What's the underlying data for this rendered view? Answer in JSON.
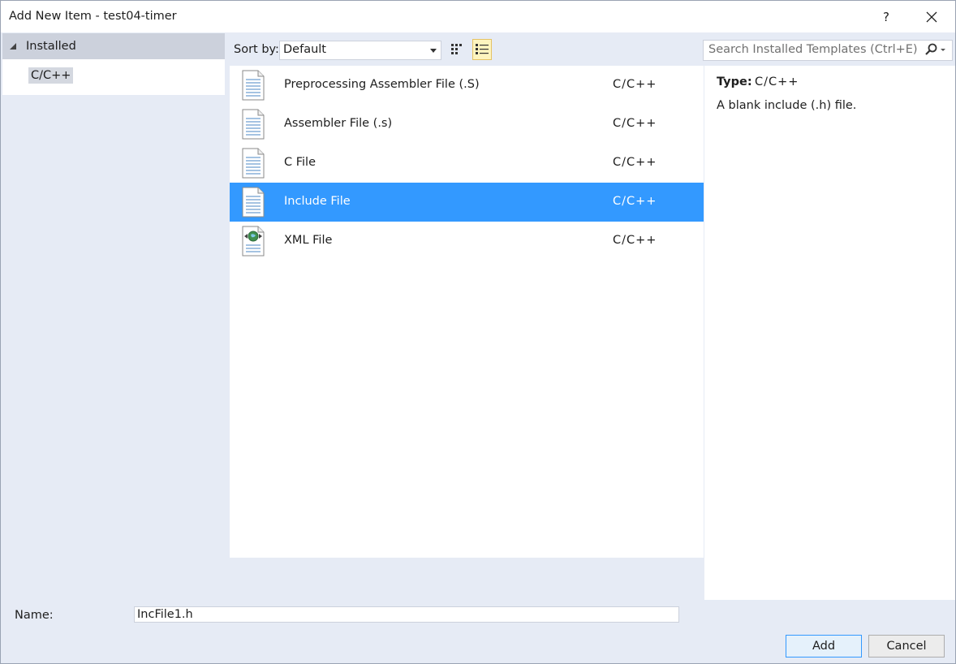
{
  "window": {
    "title": "Add New Item - test04-timer",
    "help_label": "?",
    "close_icon": "close-icon"
  },
  "tree": {
    "header_label": "Installed",
    "items": [
      {
        "label": "C/C++",
        "selected": true
      }
    ]
  },
  "toolbar": {
    "sort_label": "Sort by:",
    "sort_value": "Default",
    "view_modes": [
      "small-icons-view",
      "list-view"
    ],
    "active_view": "list-view",
    "search_placeholder": "Search Installed Templates (Ctrl+E)"
  },
  "templates": [
    {
      "name": "Preprocessing Assembler File (.S)",
      "type": "C/C++",
      "icon": "text-file-icon",
      "selected": false
    },
    {
      "name": "Assembler File (.s)",
      "type": "C/C++",
      "icon": "text-file-icon",
      "selected": false
    },
    {
      "name": "C File",
      "type": "C/C++",
      "icon": "text-file-icon",
      "selected": false
    },
    {
      "name": "Include File",
      "type": "C/C++",
      "icon": "text-file-icon",
      "selected": true
    },
    {
      "name": "XML File",
      "type": "C/C++",
      "icon": "xml-file-icon",
      "selected": false
    }
  ],
  "details": {
    "type_label": "Type:",
    "type_value": "C/C++",
    "description": "A blank include (.h) file."
  },
  "footer": {
    "name_label": "Name:",
    "name_value": "IncFile1.h",
    "add_label": "Add",
    "cancel_label": "Cancel"
  },
  "colors": {
    "selection": "#3399ff",
    "dialog_background": "#e6ebf5",
    "tree_header": "#ccd1dc"
  }
}
